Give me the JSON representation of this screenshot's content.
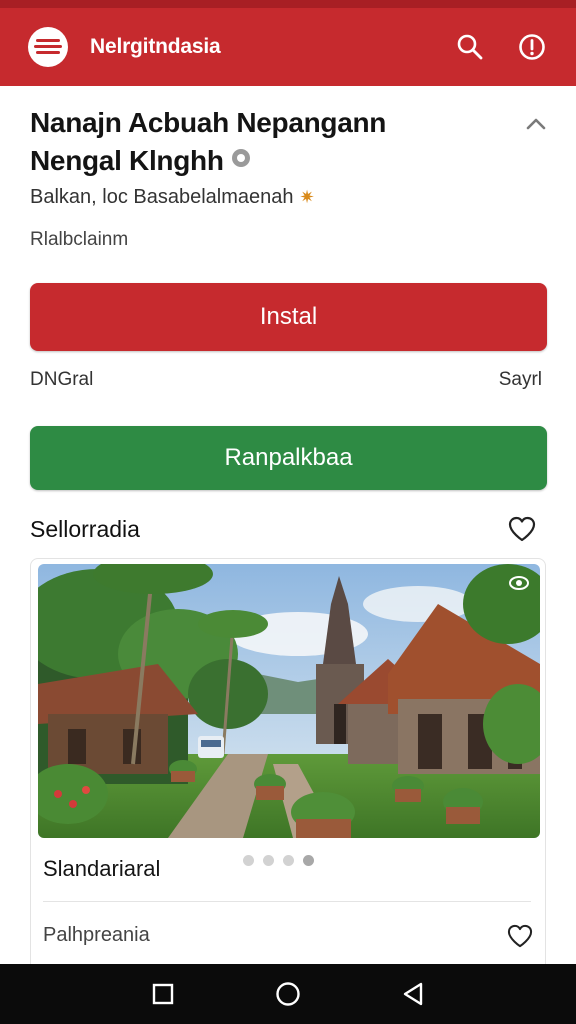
{
  "app_bar": {
    "title": "Nelrgitndasia",
    "logo_icon": "stacked-lines-logo",
    "search_icon": "search-icon",
    "info_icon": "info-icon",
    "color": "#c62a2e"
  },
  "listing": {
    "title_line1": "Nanajn Acbuah Nepangann",
    "title_line2": "Nengal Klnghh",
    "subtitle": "Balkan, loc Basabelalmaenah",
    "meta": "Rlalbclainm"
  },
  "actions": {
    "install_label": "Instal",
    "install_color": "#c62a2e",
    "left_info": "DNGral",
    "right_info": "Sayrl",
    "secondary_label": "Ranpalkbaa",
    "secondary_color": "#2e8b44"
  },
  "section": {
    "title": "Sellorradia"
  },
  "card": {
    "title": "Slandariaral",
    "subtitle": "Palhpreania",
    "carousel_dots": 4,
    "active_dot": 3
  },
  "nav": {
    "items": [
      "recents-icon",
      "home-icon",
      "back-icon"
    ]
  }
}
